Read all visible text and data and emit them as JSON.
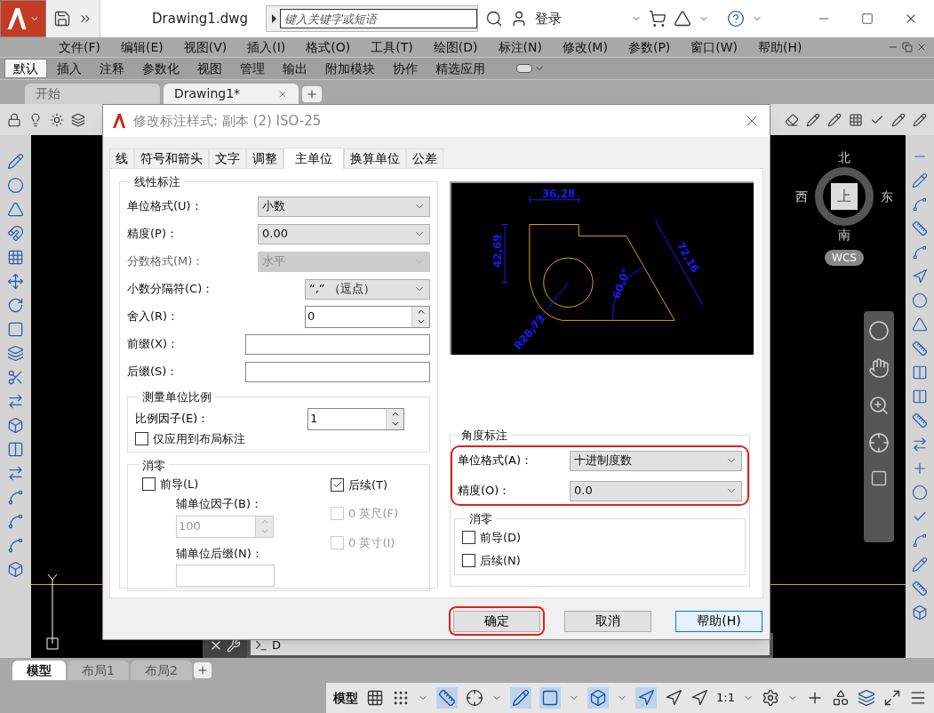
{
  "app": {
    "title": "Drawing1.dwg",
    "search": {
      "placeholder": "键入关键字或短语"
    },
    "login": "登录"
  },
  "menu": [
    "文件(F)",
    "编辑(E)",
    "视图(V)",
    "插入(I)",
    "格式(O)",
    "工具(T)",
    "绘图(D)",
    "标注(N)",
    "修改(M)",
    "参数(P)",
    "窗口(W)",
    "帮助(H)"
  ],
  "ribbon_tabs": [
    {
      "label": "默认",
      "selected": true
    },
    {
      "label": "插入",
      "selected": false
    },
    {
      "label": "注释",
      "selected": false
    },
    {
      "label": "参数化",
      "selected": false
    },
    {
      "label": "视图",
      "selected": false
    },
    {
      "label": "管理",
      "selected": false
    },
    {
      "label": "输出",
      "selected": false
    },
    {
      "label": "附加模块",
      "selected": false
    },
    {
      "label": "协作",
      "selected": false
    },
    {
      "label": "精选应用",
      "selected": false
    }
  ],
  "file_tabs": [
    {
      "label": "开始",
      "selected": false
    },
    {
      "label": "Drawing1*",
      "selected": true
    }
  ],
  "compass": {
    "north": "北",
    "west": "西",
    "top": "上",
    "east": "东",
    "south": "南",
    "ucs": "WCS"
  },
  "command_line": {
    "text": "D"
  },
  "layout_tabs": [
    {
      "label": "模型",
      "selected": true
    },
    {
      "label": "布局1",
      "selected": false
    },
    {
      "label": "布局2",
      "selected": false
    }
  ],
  "status_bar": {
    "model": "模型",
    "scale": "1:1"
  },
  "dialog": {
    "title": "修改标注样式: 副本 (2) ISO-25",
    "tabs": [
      {
        "label": "线",
        "selected": false
      },
      {
        "label": "符号和箭头",
        "selected": false
      },
      {
        "label": "文字",
        "selected": false
      },
      {
        "label": "调整",
        "selected": false
      },
      {
        "label": "主单位",
        "selected": true
      },
      {
        "label": "换算单位",
        "selected": false
      },
      {
        "label": "公差",
        "selected": false
      }
    ],
    "linear": {
      "title": "线性标注",
      "fields": [
        {
          "kind": "dropdown",
          "label": "单位格式(U)：",
          "value": "小数",
          "disabled": false
        },
        {
          "kind": "dropdown",
          "label": "精度(P)：",
          "value": "0.00",
          "disabled": false
        },
        {
          "kind": "dropdown",
          "label": "分数格式(M)：",
          "value": "水平",
          "disabled": true
        },
        {
          "kind": "dropdown",
          "label": "小数分隔符(C)：",
          "value": "“,” （逗点）",
          "disabled": false
        },
        {
          "kind": "spinner",
          "label": "舍入(R)：",
          "value": "0"
        },
        {
          "kind": "input",
          "label": "前缀(X)："
        },
        {
          "kind": "input",
          "label": "后缀(S)："
        }
      ]
    },
    "scale": {
      "title": "测量单位比例",
      "label": "比例因子(E)：",
      "value": "1",
      "layout_only": {
        "label": "仅应用到布局标注",
        "checked": false
      }
    },
    "zero": {
      "title": "消零",
      "leading": {
        "label": "前导(L)",
        "checked": false
      },
      "sub_factor": {
        "label": "辅单位因子(B)：",
        "value": "100",
        "disabled": true
      },
      "sub_suffix": {
        "label": "辅单位后缀(N)：",
        "disabled": true
      },
      "trailing": {
        "label": "后续(T)",
        "checked": true
      },
      "feet": {
        "label": "0 英尺(F)",
        "checked": false,
        "disabled": true
      },
      "inches": {
        "label": "0 英寸(I)",
        "checked": false,
        "disabled": true
      }
    },
    "preview": {
      "labels": [
        "36,28",
        "42,69",
        "72,16",
        "60,0°",
        "R28,73"
      ]
    },
    "angular": {
      "title": "角度标注",
      "highlighted": true,
      "unit_format": {
        "label": "单位格式(A)：",
        "value": "十进制度数"
      },
      "precision": {
        "label": "精度(O)：",
        "value": "0.0"
      },
      "zero": {
        "title": "消零",
        "items": [
          {
            "label": "前导(D)",
            "checked": false
          },
          {
            "label": "后续(N)",
            "checked": false
          }
        ]
      }
    },
    "buttons": [
      {
        "label": "确定",
        "highlighted": true
      },
      {
        "label": "取消",
        "highlighted": false
      },
      {
        "label": "帮助(H)",
        "highlighted": false
      }
    ]
  }
}
